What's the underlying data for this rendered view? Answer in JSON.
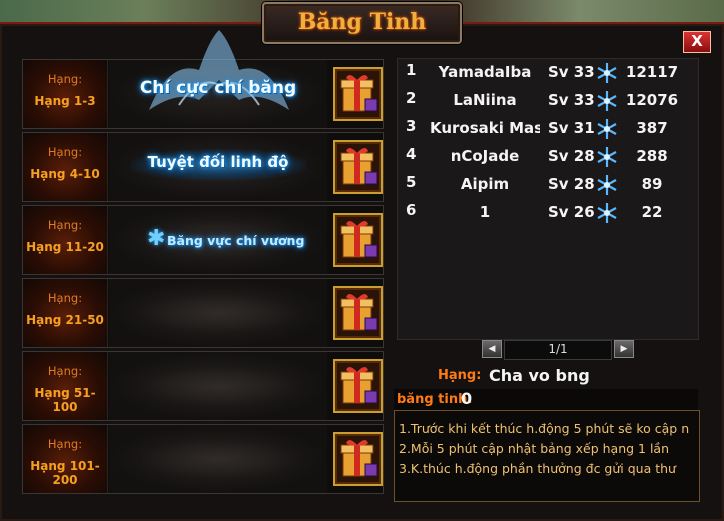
{
  "window": {
    "title": "Băng Tinh",
    "close_label": "X"
  },
  "rank_label": "Hạng:",
  "tiers": [
    {
      "range": "Hạng 1-3",
      "title": "Chí cực chí băng",
      "reward_icon": "gift-box-icon"
    },
    {
      "range": "Hạng 4-10",
      "title": "Tuyệt đối linh độ",
      "reward_icon": "gift-box-icon"
    },
    {
      "range": "Hạng 11-20",
      "title": "Băng vực chí vương",
      "reward_icon": "gift-box-icon"
    },
    {
      "range": "Hạng 21-50",
      "title": "",
      "reward_icon": "gift-box-icon"
    },
    {
      "range": "Hạng 51-100",
      "title": "",
      "reward_icon": "gift-box-icon"
    },
    {
      "range": "Hạng 101-200",
      "title": "",
      "reward_icon": "gift-box-icon"
    }
  ],
  "leaderboard": [
    {
      "pos": "1",
      "name": "YamadaIba",
      "server": "Sv 33",
      "score": "12117"
    },
    {
      "pos": "2",
      "name": "LaNiina",
      "server": "Sv 33",
      "score": "12076"
    },
    {
      "pos": "3",
      "name": "Kurosaki Mas",
      "server": "Sv 31",
      "score": "387"
    },
    {
      "pos": "4",
      "name": "nCoJade",
      "server": "Sv 28",
      "score": "288"
    },
    {
      "pos": "5",
      "name": "Aipim",
      "server": "Sv 28",
      "score": "89"
    },
    {
      "pos": "6",
      "name": "1",
      "server": "Sv 26",
      "score": "22"
    }
  ],
  "pagination": {
    "page_text": "1/1"
  },
  "my_stats": {
    "rank_label": "Hạng:",
    "rank_value": "Cha vo bng",
    "crystal_label": "băng tinh:",
    "crystal_value": "0"
  },
  "notes": [
    "1.Trước khi kết thúc h.động 5 phút sẽ ko cập n",
    "2.Mỗi 5 phút cập nhật bảng xếp hạng 1 lần",
    "3.K.thúc h.động phần thưởng đc gửi qua thư"
  ],
  "colors": {
    "accent": "#ff7a14",
    "ice": "#2aa8ff",
    "rank_text": "#f7a020"
  }
}
